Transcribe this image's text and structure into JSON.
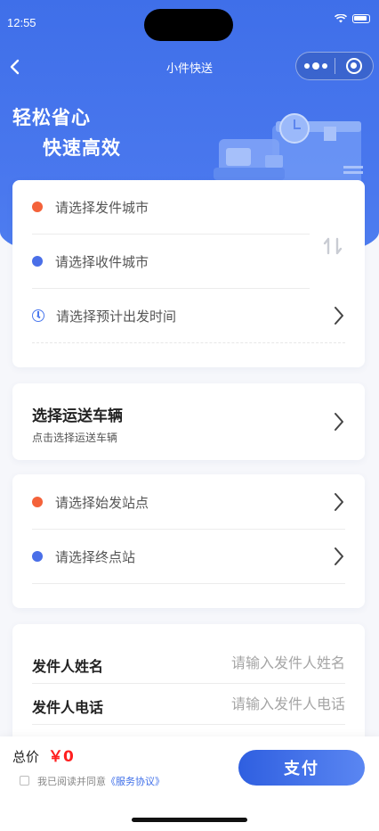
{
  "status": {
    "time": "12:55"
  },
  "nav": {
    "title": "小件快送"
  },
  "hero": {
    "line1": "轻松省心",
    "line2": "快速高效"
  },
  "route": {
    "sender_city": "请选择发件城市",
    "receiver_city": "请选择收件城市",
    "depart_time": "请选择预计出发时间"
  },
  "vehicle": {
    "title": "选择运送车辆",
    "subtitle": "点击选择运送车辆"
  },
  "stations": {
    "start": "请选择始发站点",
    "end": "请选择终点站"
  },
  "form": {
    "sender_name_label": "发件人姓名",
    "sender_name_placeholder": "请输入发件人姓名",
    "sender_phone_label": "发件人电话",
    "sender_phone_placeholder": "请输入发件人电话"
  },
  "footer": {
    "total_label": "总价",
    "total_value": "￥0",
    "agree_text": "我已阅读并同意",
    "agree_link": "《服务协议》",
    "pay_label": "支付"
  },
  "colors": {
    "primary": "#4a78ee",
    "sender_dot": "#f4623a",
    "receiver_dot": "#4a6fe8",
    "price": "#ff1f1f"
  },
  "icons": [
    "back-icon",
    "more-icon",
    "close-icon",
    "clock-icon",
    "swap-icon",
    "chevron-right-icon",
    "wifi-icon",
    "battery-icon"
  ]
}
